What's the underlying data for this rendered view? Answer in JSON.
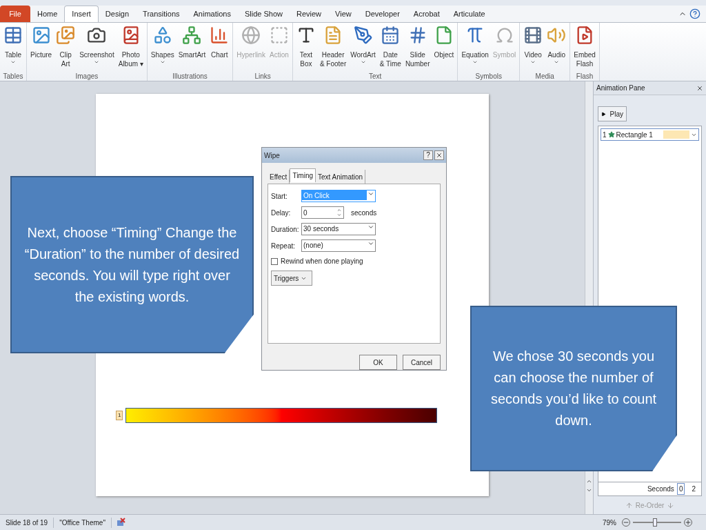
{
  "tabs": [
    {
      "label": "File",
      "kind": "file",
      "selected": false
    },
    {
      "label": "Home",
      "kind": "tab",
      "selected": false
    },
    {
      "label": "Insert",
      "kind": "tab",
      "selected": true
    },
    {
      "label": "Design",
      "kind": "tab",
      "selected": false
    },
    {
      "label": "Transitions",
      "kind": "tab",
      "selected": false
    },
    {
      "label": "Animations",
      "kind": "tab",
      "selected": false
    },
    {
      "label": "Slide Show",
      "kind": "tab",
      "selected": false
    },
    {
      "label": "Review",
      "kind": "tab",
      "selected": false
    },
    {
      "label": "View",
      "kind": "tab",
      "selected": false
    },
    {
      "label": "Developer",
      "kind": "tab",
      "selected": false
    },
    {
      "label": "Acrobat",
      "kind": "tab",
      "selected": false
    },
    {
      "label": "Articulate",
      "kind": "tab",
      "selected": false
    }
  ],
  "ribbon": [
    {
      "label": "Tables",
      "buttons": [
        {
          "lines": [
            "Table"
          ],
          "dropdown": true,
          "disabled": false
        }
      ]
    },
    {
      "label": "Images",
      "buttons": [
        {
          "lines": [
            "Picture"
          ],
          "dropdown": false,
          "disabled": false
        },
        {
          "lines": [
            "Clip",
            "Art"
          ],
          "dropdown": false,
          "disabled": false
        },
        {
          "lines": [
            "Screenshot"
          ],
          "dropdown": true,
          "disabled": false
        },
        {
          "lines": [
            "Photo",
            "Album ▾"
          ],
          "dropdown": false,
          "disabled": false
        }
      ]
    },
    {
      "label": "Illustrations",
      "buttons": [
        {
          "lines": [
            "Shapes"
          ],
          "dropdown": true,
          "disabled": false
        },
        {
          "lines": [
            "SmartArt"
          ],
          "dropdown": false,
          "disabled": false
        },
        {
          "lines": [
            "Chart"
          ],
          "dropdown": false,
          "disabled": false
        }
      ]
    },
    {
      "label": "Links",
      "buttons": [
        {
          "lines": [
            "Hyperlink"
          ],
          "dropdown": false,
          "disabled": true
        },
        {
          "lines": [
            "Action"
          ],
          "dropdown": false,
          "disabled": true
        }
      ]
    },
    {
      "label": "Text",
      "buttons": [
        {
          "lines": [
            "Text",
            "Box"
          ],
          "dropdown": false,
          "disabled": false
        },
        {
          "lines": [
            "Header",
            "& Footer"
          ],
          "dropdown": false,
          "disabled": false
        },
        {
          "lines": [
            "WordArt"
          ],
          "dropdown": true,
          "disabled": false
        },
        {
          "lines": [
            "Date",
            "& Time"
          ],
          "dropdown": false,
          "disabled": false
        },
        {
          "lines": [
            "Slide",
            "Number"
          ],
          "dropdown": false,
          "disabled": false
        },
        {
          "lines": [
            "Object"
          ],
          "dropdown": false,
          "disabled": false
        }
      ]
    },
    {
      "label": "Symbols",
      "buttons": [
        {
          "lines": [
            "Equation"
          ],
          "dropdown": true,
          "disabled": false
        },
        {
          "lines": [
            "Symbol"
          ],
          "dropdown": false,
          "disabled": true
        }
      ]
    },
    {
      "label": "Media",
      "buttons": [
        {
          "lines": [
            "Video"
          ],
          "dropdown": true,
          "disabled": false
        },
        {
          "lines": [
            "Audio"
          ],
          "dropdown": true,
          "disabled": false
        }
      ]
    },
    {
      "label": "Flash",
      "buttons": [
        {
          "lines": [
            "Embed",
            "Flash"
          ],
          "dropdown": false,
          "disabled": false
        }
      ]
    }
  ],
  "slide": {
    "timer_badge": "1"
  },
  "callouts": [
    {
      "text": "Next, choose “Timing” Change the “Duration” to the number of desired seconds. You will type right over the existing words."
    },
    {
      "text": "We chose 30 seconds you can choose the number of seconds you’d like to count down."
    }
  ],
  "dialog": {
    "title": "Wipe",
    "help": "?",
    "tabs": [
      {
        "label": "Effect",
        "selected": false
      },
      {
        "label": "Timing",
        "selected": true
      },
      {
        "label": "Text Animation",
        "selected": false
      }
    ],
    "fields": [
      {
        "label": "Start:",
        "kind": "select",
        "value": "On Click",
        "highlighted": true
      },
      {
        "label": "Delay:",
        "kind": "spin",
        "value": "0",
        "suffix": "seconds"
      },
      {
        "label": "Duration:",
        "kind": "select",
        "value": "30 seconds",
        "highlighted": false
      },
      {
        "label": "Repeat:",
        "kind": "select",
        "value": "(none)",
        "highlighted": false
      }
    ],
    "rewind": {
      "label": "Rewind when done playing",
      "checked": false
    },
    "triggers": "Triggers",
    "buttons": [
      "OK",
      "Cancel"
    ]
  },
  "animation_pane": {
    "title": "Animation Pane",
    "play": "Play",
    "items": [
      {
        "number": "1",
        "name": "Rectangle 1",
        "selected": true,
        "color": "#fde7b3"
      }
    ],
    "timeline": {
      "unit": "Seconds",
      "ticks": [
        "0",
        "2"
      ]
    },
    "reorder": "Re-Order"
  },
  "status_bar": {
    "slide": "Slide 18 of 19",
    "theme": "\"Office Theme\"",
    "zoom": "79%",
    "level": 0.45
  }
}
